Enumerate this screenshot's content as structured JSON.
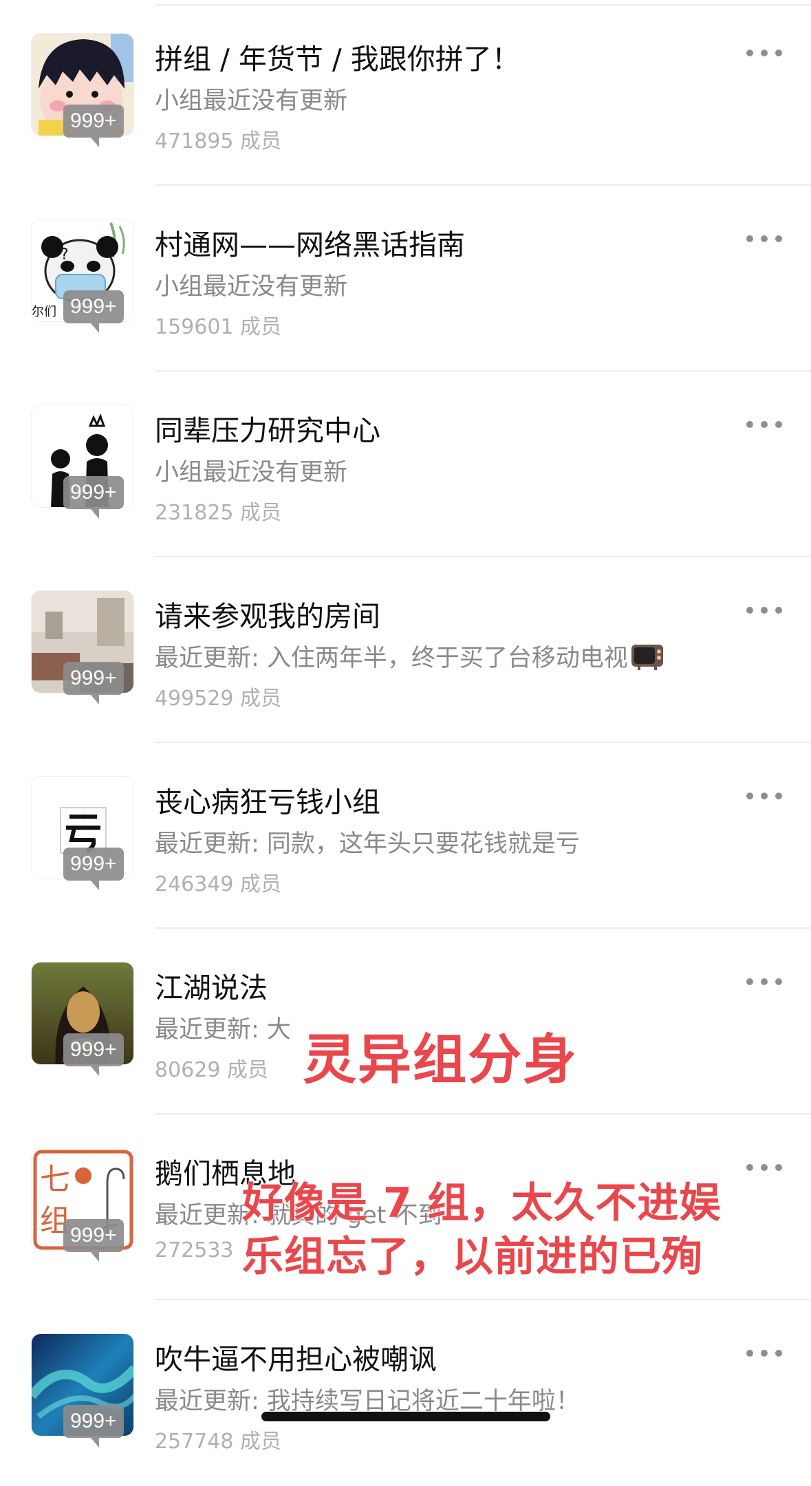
{
  "groups": [
    {
      "name": "拼组 / 年货节 / 我跟你拼了！",
      "update": "小组最近没有更新",
      "members": "471895 成员",
      "badge": "999+",
      "avatar_icon": "cartoon-girl-avatar-icon"
    },
    {
      "name": "村通网——网络黑话指南",
      "update": "小组最近没有更新",
      "members": "159601 成员",
      "badge": "999+",
      "avatar_icon": "panda-mask-meme-avatar-icon"
    },
    {
      "name": "同辈压力研究中心",
      "update": "小组最近没有更新",
      "members": "231825 成员",
      "badge": "999+",
      "avatar_icon": "stick-figures-crown-avatar-icon"
    },
    {
      "name": "请来参观我的房间",
      "update": "最近更新: 入住两年半，终于买了台移动电视",
      "members": "499529 成员",
      "badge": "999+",
      "avatar_icon": "room-photo-avatar-icon",
      "update_icon": "tv-emoji-icon"
    },
    {
      "name": "丧心病狂亏钱小组",
      "update": "最近更新: 同款，这年头只要花钱就是亏",
      "members": "246349 成员",
      "badge": "999+",
      "avatar_icon": "kui-character-avatar-icon"
    },
    {
      "name": "江湖说法",
      "update": "最近更新: 大",
      "members": "80629 成员",
      "badge": "999+",
      "avatar_icon": "mona-lisa-avatar-icon"
    },
    {
      "name": "鹅们栖息地",
      "update": "最近更新: 就真的 get 不到",
      "members": "272533",
      "badge": "999+",
      "avatar_icon": "qi-zu-goose-avatar-icon"
    },
    {
      "name": "吹牛逼不用担心被嘲讽",
      "update": "最近更新: 我持续写日记将近二十年啦！",
      "members": "257748 成员",
      "badge": "999+",
      "avatar_icon": "aurora-avatar-icon"
    }
  ],
  "overlay": {
    "line1": "灵异组分身",
    "line2": "好像是 7 组，太久不进娱",
    "line3": "乐组忘了，以前进的已殉"
  },
  "colors": {
    "overlay_red": "#e9474c",
    "badge_gray": "#8c8c8c",
    "divider": "#ececec"
  }
}
